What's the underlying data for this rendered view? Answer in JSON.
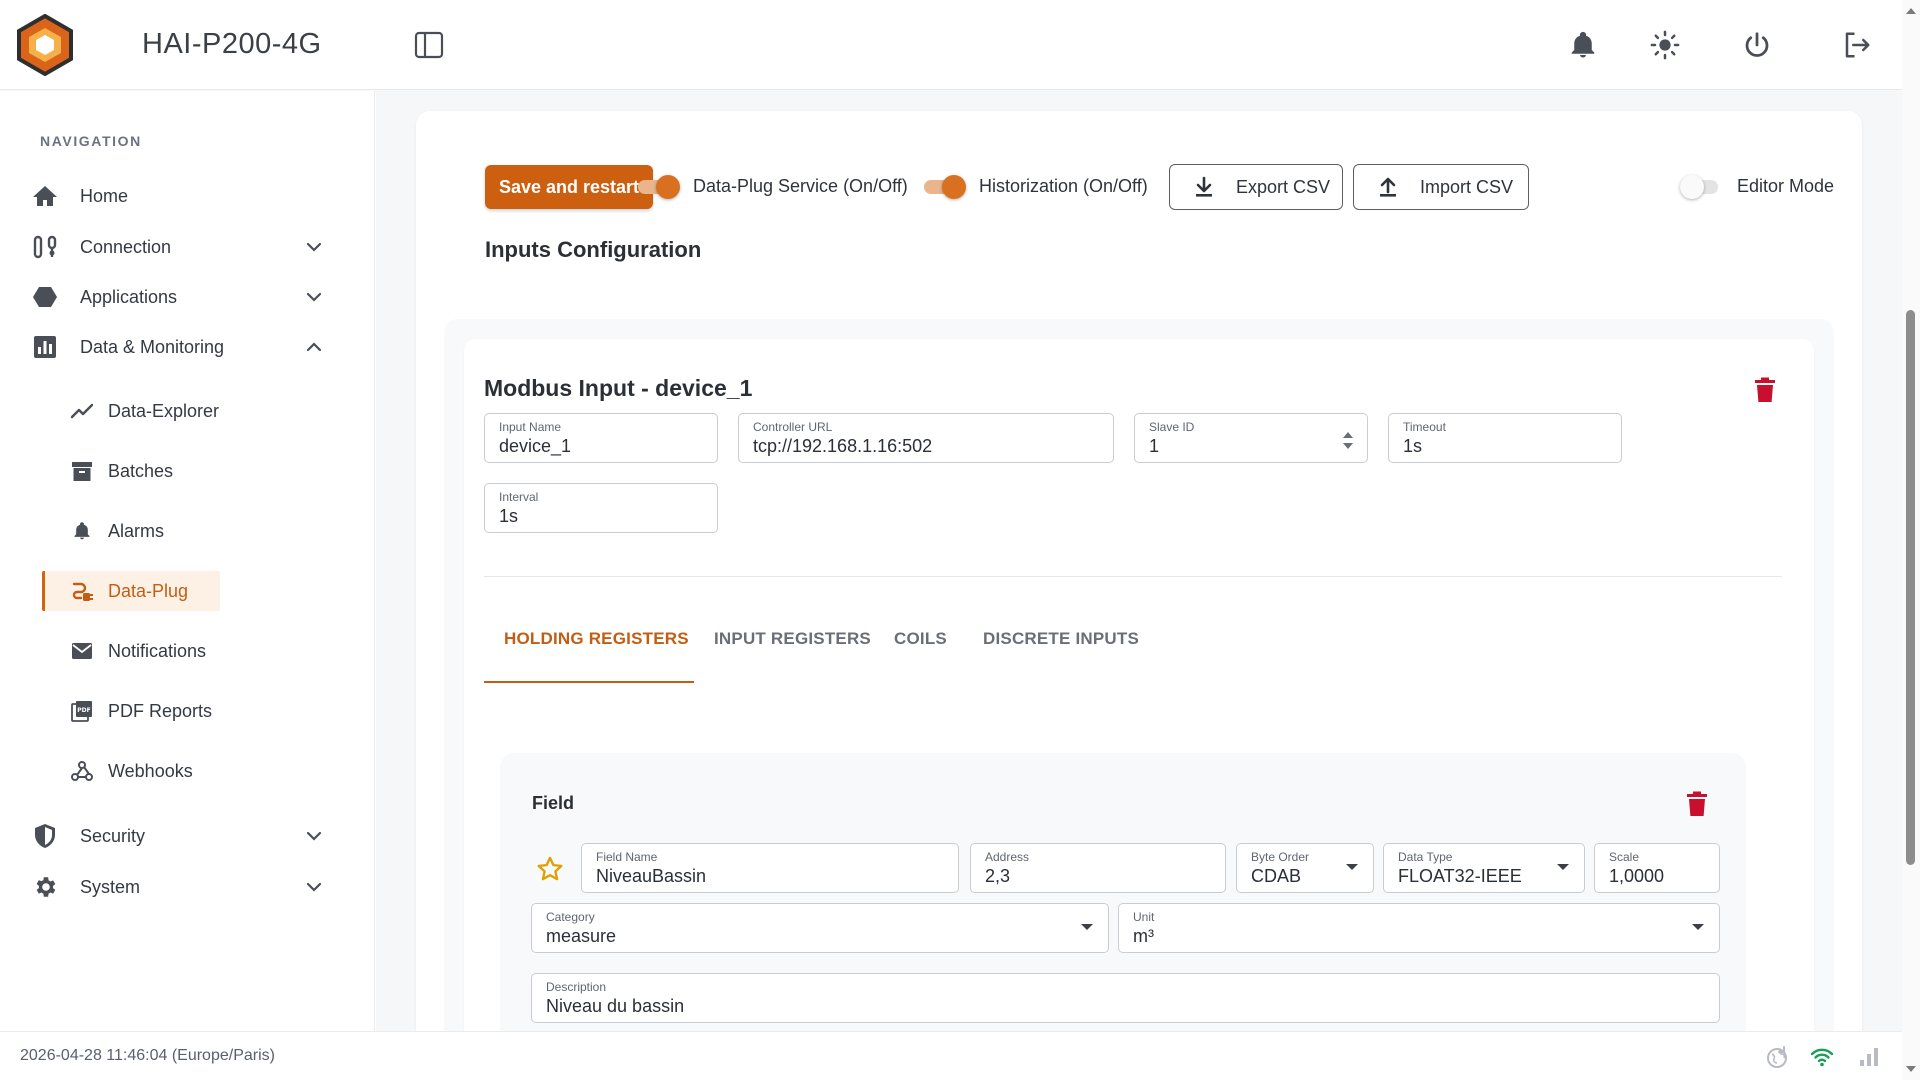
{
  "header": {
    "device_name": "HAI-P200-4G",
    "icons": [
      "logo-icon",
      "sidebar-toggle-icon",
      "bell-icon",
      "sun-icon",
      "power-icon",
      "logout-icon"
    ]
  },
  "sidebar": {
    "heading": "NAVIGATION",
    "items": [
      {
        "label": "Home",
        "icon": "home-icon"
      },
      {
        "label": "Connection",
        "icon": "connection-icon"
      },
      {
        "label": "Applications",
        "icon": "hexagon-icon"
      },
      {
        "label": "Data & Monitoring",
        "icon": "chart-icon"
      },
      {
        "label": "Security",
        "icon": "shield-icon"
      },
      {
        "label": "System",
        "icon": "gear-icon"
      }
    ],
    "sub_items": [
      {
        "label": "Data-Explorer",
        "icon": "trend-icon"
      },
      {
        "label": "Batches",
        "icon": "archive-icon"
      },
      {
        "label": "Alarms",
        "icon": "bell-icon"
      },
      {
        "label": "Data-Plug",
        "icon": "plug-icon"
      },
      {
        "label": "Notifications",
        "icon": "mail-icon"
      },
      {
        "label": "PDF Reports",
        "icon": "pdf-icon"
      },
      {
        "label": "Webhooks",
        "icon": "webhook-icon"
      }
    ],
    "active_item": "Data-Plug"
  },
  "toolbar": {
    "save_label": "Save and restart",
    "service_label": "Data-Plug Service (On/Off)",
    "historization_label": "Historization (On/Off)",
    "export_label": "Export CSV",
    "import_label": "Import CSV",
    "editor_label": "Editor Mode"
  },
  "section_title": "Inputs Configuration",
  "input": {
    "title": "Modbus Input - device_1",
    "fields": {
      "input_name": {
        "label": "Input Name",
        "value": "device_1"
      },
      "controller_url": {
        "label": "Controller URL",
        "value": "tcp://192.168.1.16:502"
      },
      "slave_id": {
        "label": "Slave ID",
        "value": "1"
      },
      "timeout": {
        "label": "Timeout",
        "value": "1s"
      },
      "interval": {
        "label": "Interval",
        "value": "1s"
      }
    },
    "tabs": [
      "HOLDING REGISTERS",
      "INPUT REGISTERS",
      "COILS",
      "DISCRETE INPUTS"
    ]
  },
  "field_entry": {
    "title": "Field",
    "field_name": {
      "label": "Field Name",
      "value": "NiveauBassin"
    },
    "address": {
      "label": "Address",
      "value": "2,3"
    },
    "byte_order": {
      "label": "Byte Order",
      "value": "CDAB"
    },
    "data_type": {
      "label": "Data Type",
      "value": "FLOAT32-IEEE"
    },
    "scale": {
      "label": "Scale",
      "value": "1,0000"
    },
    "category": {
      "label": "Category",
      "value": "measure"
    },
    "unit": {
      "label": "Unit",
      "value": "m³"
    },
    "description": {
      "label": "Description",
      "value": "Niveau du bassin"
    }
  },
  "footer": {
    "datetime": "2026-04-28 11:46:04 (Europe/Paris)"
  },
  "colors": {
    "accent": "#cd5f10",
    "active_text": "#c25e14",
    "danger": "#c8102e",
    "wifi": "#1a9e55"
  }
}
